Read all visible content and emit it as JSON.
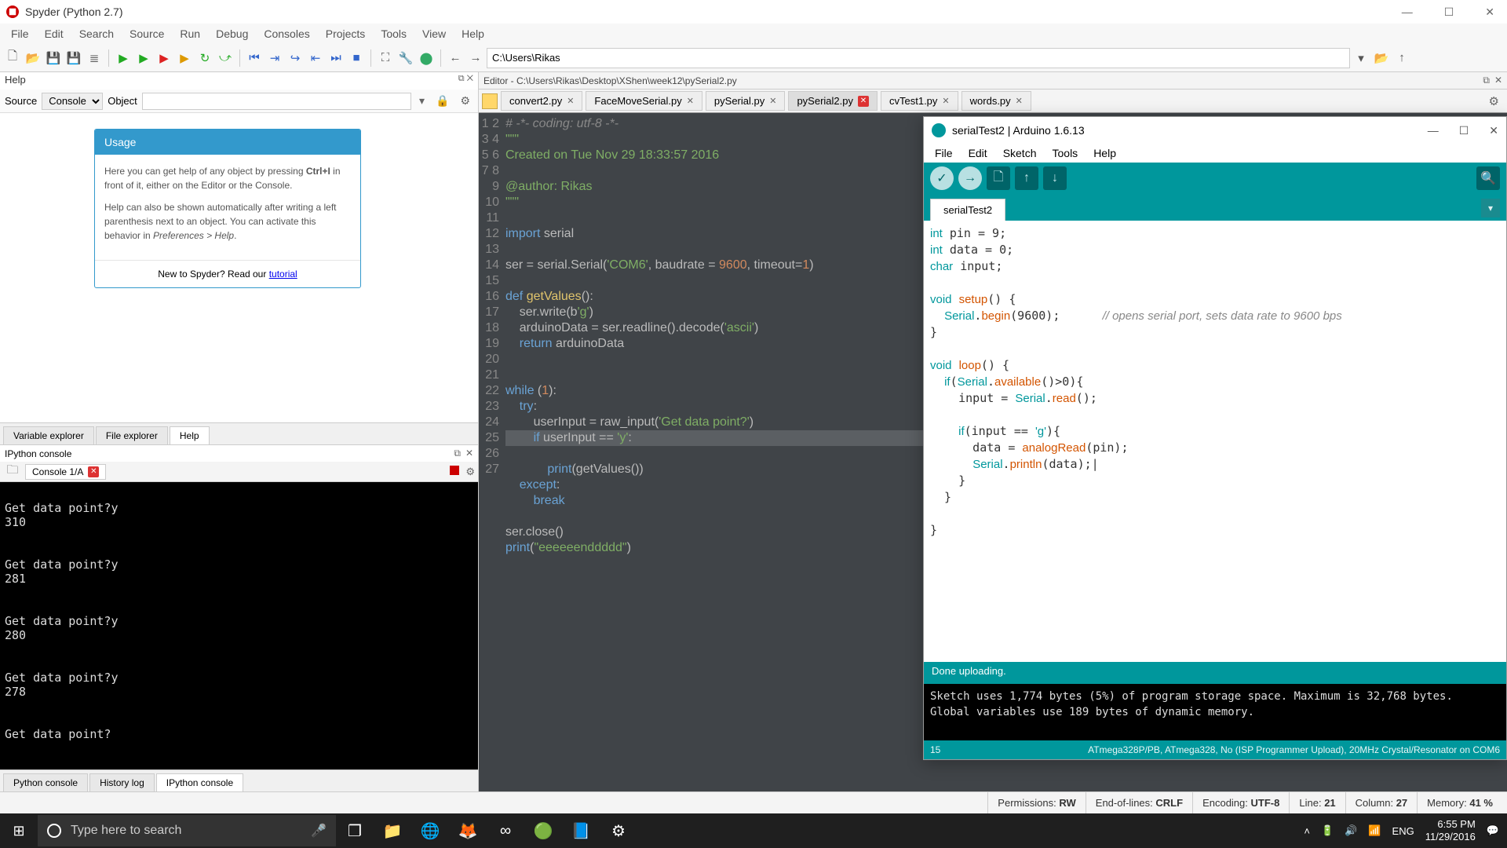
{
  "window": {
    "title": "Spyder (Python 2.7)"
  },
  "menus": [
    "File",
    "Edit",
    "Search",
    "Source",
    "Run",
    "Debug",
    "Consoles",
    "Projects",
    "Tools",
    "View",
    "Help"
  ],
  "toolbar": {
    "path": "C:\\Users\\Rikas"
  },
  "help_pane": {
    "label": "Help",
    "source_label": "Source",
    "source_value": "Console",
    "object_label": "Object",
    "card_title": "Usage",
    "p1a": "Here you can get help of any object by pressing ",
    "p1b": "Ctrl+I",
    "p1c": " in front of it, either on the Editor or the Console.",
    "p2a": "Help can also be shown automatically after writing a left parenthesis next to an object. You can activate this behavior in ",
    "p2b": "Preferences > Help",
    "newto": "New to Spyder? Read our ",
    "tutorial": "tutorial"
  },
  "left_tabs": [
    "Variable explorer",
    "File explorer",
    "Help"
  ],
  "ipy": {
    "header": "IPython console",
    "tab": "Console 1/A",
    "content": "\nGet data point?y\n310\n\n\nGet data point?y\n281\n\n\nGet data point?y\n280\n\n\nGet data point?y\n278\n\n\nGet data point?"
  },
  "bottom_tabs": [
    "Python console",
    "History log",
    "IPython console"
  ],
  "editor": {
    "header": "Editor - C:\\Users\\Rikas\\Desktop\\XShen\\week12\\pySerial2.py",
    "tabs": [
      "convert2.py",
      "FaceMoveSerial.py",
      "pySerial.py",
      "pySerial2.py",
      "cvTest1.py",
      "words.py"
    ],
    "active_tab": 3,
    "gutter": [
      "1",
      "2",
      "3",
      "4",
      "5",
      "6",
      "7",
      "8",
      "9",
      "10",
      "11",
      "12",
      "13",
      "14",
      "15",
      "16",
      "17",
      "18",
      "19",
      "20",
      "21",
      "22",
      "23",
      "24",
      "25",
      "26",
      "27"
    ]
  },
  "status": {
    "perm_l": "Permissions:",
    "perm_v": "RW",
    "eol_l": "End-of-lines:",
    "eol_v": "CRLF",
    "enc_l": "Encoding:",
    "enc_v": "UTF-8",
    "line_l": "Line:",
    "line_v": "21",
    "col_l": "Column:",
    "col_v": "27",
    "mem_l": "Memory:",
    "mem_v": "41 %"
  },
  "taskbar": {
    "search_placeholder": "Type here to search",
    "lang": "ENG",
    "time": "6:55 PM",
    "date": "11/29/2016"
  },
  "arduino": {
    "title": "serialTest2 | Arduino 1.6.13",
    "menus": [
      "File",
      "Edit",
      "Sketch",
      "Tools",
      "Help"
    ],
    "tab": "serialTest2",
    "status": "Done uploading.",
    "out1": "Sketch uses 1,774 bytes (5%) of program storage space. Maximum is 32,768 bytes.",
    "out2": "Global variables use 189 bytes of dynamic memory.",
    "foot_l": "15",
    "foot_r": "ATmega328P/PB, ATmega328, No (ISP Programmer Upload), 20MHz Crystal/Resonator on COM6"
  }
}
